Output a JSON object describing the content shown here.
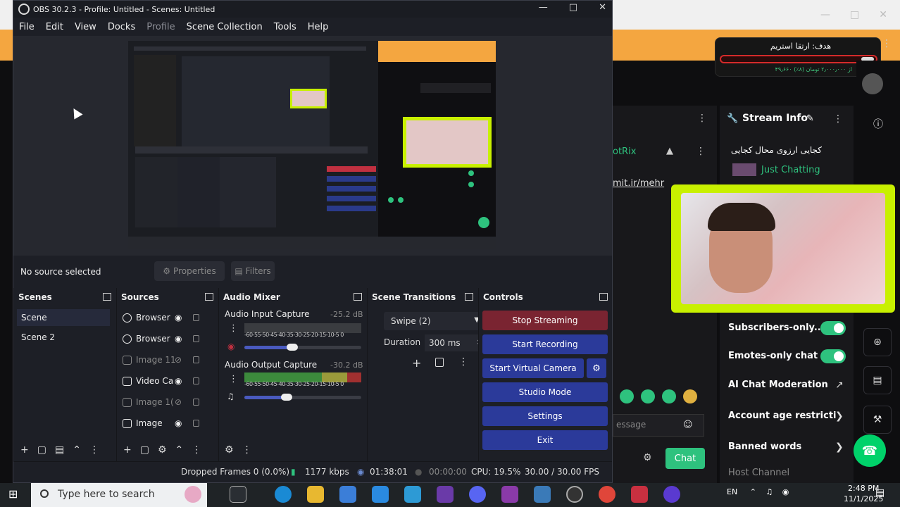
{
  "window": {
    "title": "OBS 30.2.3 - Profile: Untitled - Scenes: Untitled"
  },
  "menu": [
    "File",
    "Edit",
    "View",
    "Docks",
    "Profile",
    "Scene Collection",
    "Tools",
    "Help"
  ],
  "source_bar": {
    "no_source": "No source selected",
    "properties": "Properties",
    "filters": "Filters"
  },
  "docks": {
    "scenes": "Scenes",
    "sources": "Sources",
    "audio_mixer": "Audio Mixer",
    "scene_transitions": "Scene Transitions",
    "controls": "Controls"
  },
  "scenes": [
    "Scene",
    "Scene 2"
  ],
  "sources": [
    {
      "name": "Browser",
      "dim": false
    },
    {
      "name": "Browser",
      "dim": false
    },
    {
      "name": "Image 11",
      "dim": true
    },
    {
      "name": "Video Ca",
      "dim": false
    },
    {
      "name": "Image 1(",
      "dim": true
    },
    {
      "name": "Image",
      "dim": false
    }
  ],
  "audio": {
    "input": {
      "name": "Audio Input Capture",
      "db": "-25.2 dB"
    },
    "output": {
      "name": "Audio Output Capture",
      "db": "-30.2 dB"
    },
    "scale": "-60-55-50-45-40-35-30-25-20-15-10-5 0",
    "scale2": "-60-55-50-45-40-35-30-25-20-15-10-5 0"
  },
  "transitions": {
    "selected": "Swipe (2)",
    "duration_label": "Duration",
    "duration_value": "300 ms"
  },
  "controls": {
    "stop_streaming": "Stop Streaming",
    "start_recording": "Start Recording",
    "start_virtual_camera": "Start Virtual Camera",
    "studio_mode": "Studio Mode",
    "settings": "Settings",
    "exit": "Exit"
  },
  "status": {
    "dropped": "Dropped Frames 0 (0.0%)",
    "kbps": "1177 kbps",
    "stream_time": "01:38:01",
    "rec_time": "00:00:00",
    "cpu": "CPU: 19.5%",
    "fps": "30.00 / 30.00 FPS"
  },
  "twitch": {
    "goal_title": "هدف: ارتقا استریم",
    "goal_sub": "۴۹٫۶۶۰ از ۲٫۰۰۰٫۰۰۰ تومان (۸٪)",
    "chat_name": "otRix",
    "chat_link": "mit.ir/mehr",
    "stream_info": "Stream Info",
    "stream_title": "کجایی ارزوی محال کجایی",
    "category": "Just Chatting",
    "settings": [
      {
        "label": "Subscribers-only...",
        "type": "toggle"
      },
      {
        "label": "Emotes-only chat",
        "type": "toggle"
      },
      {
        "label": "AI Chat Moderation",
        "type": "link"
      },
      {
        "label": "Account age restricti",
        "type": "chevron"
      },
      {
        "label": "Banned words",
        "type": "chevron"
      },
      {
        "label": "Host Channel",
        "type": "none"
      }
    ],
    "chat_placeholder": "essage",
    "chat_button": "Chat"
  },
  "taskbar": {
    "search_placeholder": "Type here to search",
    "lang": "EN",
    "time": "2:48 PM",
    "date": "11/1/2025"
  },
  "colors": {
    "accent_green": "#2ec27e",
    "stop_red": "#7a2431",
    "obs_blue": "#2b3a9a",
    "cam_border": "#c8f000"
  }
}
